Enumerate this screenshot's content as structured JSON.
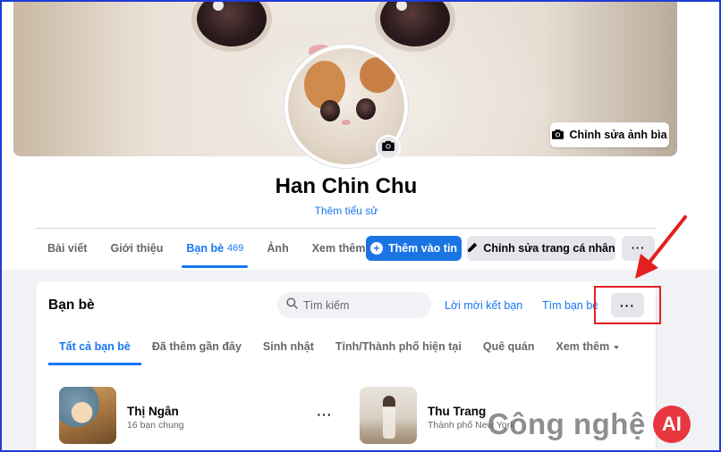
{
  "profile": {
    "name": "Han Chin Chu",
    "bio_link": "Thêm tiểu sử",
    "edit_cover_label": "Chỉnh sửa ảnh bìa"
  },
  "nav": {
    "tabs": [
      {
        "label": "Bài viết"
      },
      {
        "label": "Giới thiệu"
      },
      {
        "label": "Bạn bè",
        "count": "469",
        "active": true
      },
      {
        "label": "Ảnh"
      },
      {
        "label": "Xem thêm"
      }
    ],
    "add_story_label": "Thêm vào tin",
    "edit_profile_label": "Chỉnh sửa trang cá nhân",
    "more_label": "···"
  },
  "friends_section": {
    "title": "Bạn bè",
    "search_placeholder": "Tìm kiếm",
    "friend_requests_label": "Lời mời kết bạn",
    "find_friends_label": "Tìm bạn bè",
    "more_label": "···",
    "subtabs": [
      {
        "label": "Tất cả bạn bè",
        "active": true
      },
      {
        "label": "Đã thêm gần đây"
      },
      {
        "label": "Sinh nhật"
      },
      {
        "label": "Tỉnh/Thành phố hiện tại"
      },
      {
        "label": "Quê quán"
      },
      {
        "label": "Xem thêm"
      }
    ],
    "friends": [
      {
        "name": "Thị Ngân",
        "subtitle": "16 bạn chung"
      },
      {
        "name": "Thu Trang",
        "subtitle": "Thành phố New York"
      }
    ]
  },
  "watermark": {
    "text": "Công nghệ",
    "badge": "AI"
  },
  "colors": {
    "accent": "#1877f2",
    "highlight": "#e32020",
    "frame": "#1f3bd6"
  }
}
